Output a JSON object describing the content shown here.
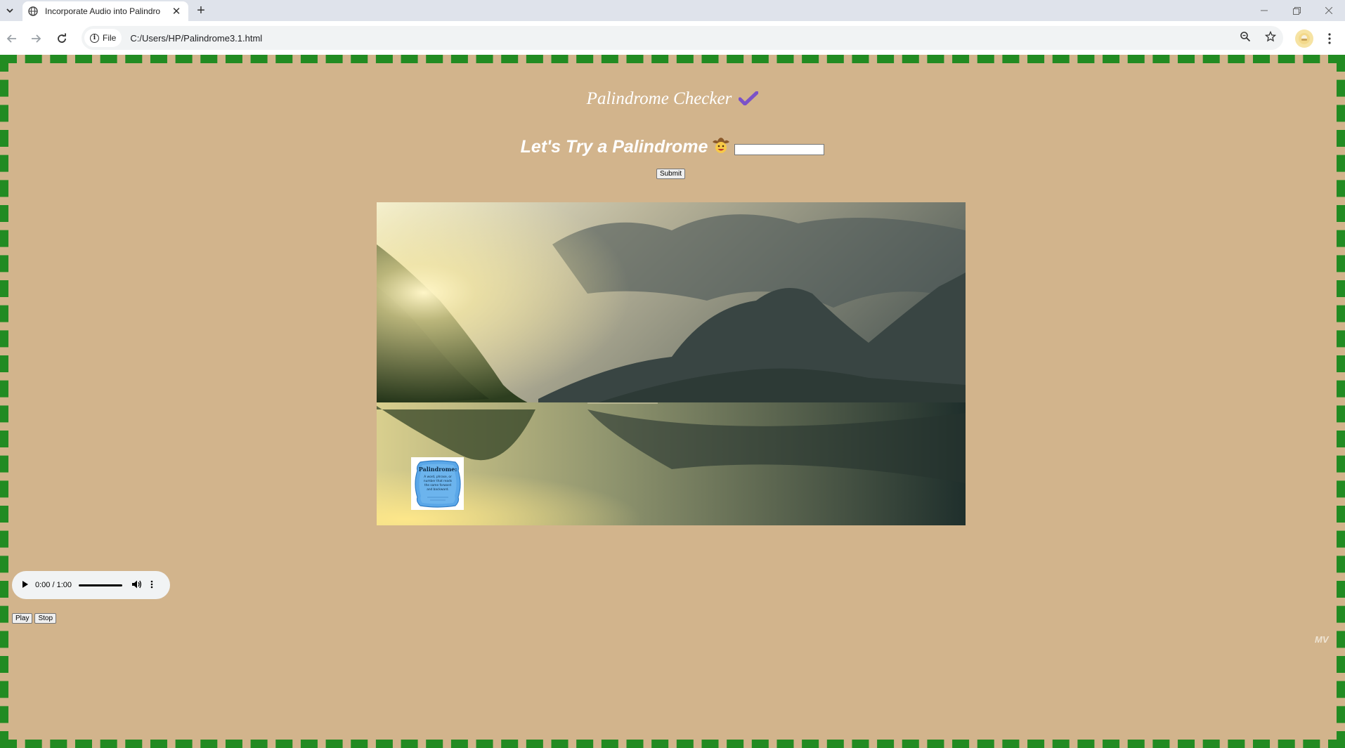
{
  "browser": {
    "tab_title": "Incorporate Audio into Palindro",
    "tab_close": "✕",
    "new_tab": "+",
    "site_chip": "File",
    "url": "C:/Users/HP/Palindrome3.1.html",
    "icons": {
      "tab_search": "chevron-down-icon",
      "tab_favicon": "globe-icon",
      "back": "arrow-left-icon",
      "forward": "arrow-right-icon",
      "reload": "reload-icon",
      "info": "info-icon",
      "zoom": "zoom-icon",
      "bookmark": "star-icon",
      "profile": "profile-avatar-icon",
      "menu": "kebab-menu-icon"
    }
  },
  "page": {
    "background_color": "#d2b48c",
    "border_color": "#228b22",
    "title": "Palindrome Checker",
    "check_icon_color": "#7b52c8",
    "try_heading": "Let's Try a Palindrome",
    "input_value": "",
    "submit_label": "Submit",
    "card": {
      "heading": "Palindrome:",
      "text": "A word, phrase, or number that reads the same forward and backward."
    },
    "audio": {
      "time": "0:00 / 1:00",
      "progress": 0
    },
    "play_label": "Play",
    "stop_label": "Stop",
    "initials": "MV"
  }
}
